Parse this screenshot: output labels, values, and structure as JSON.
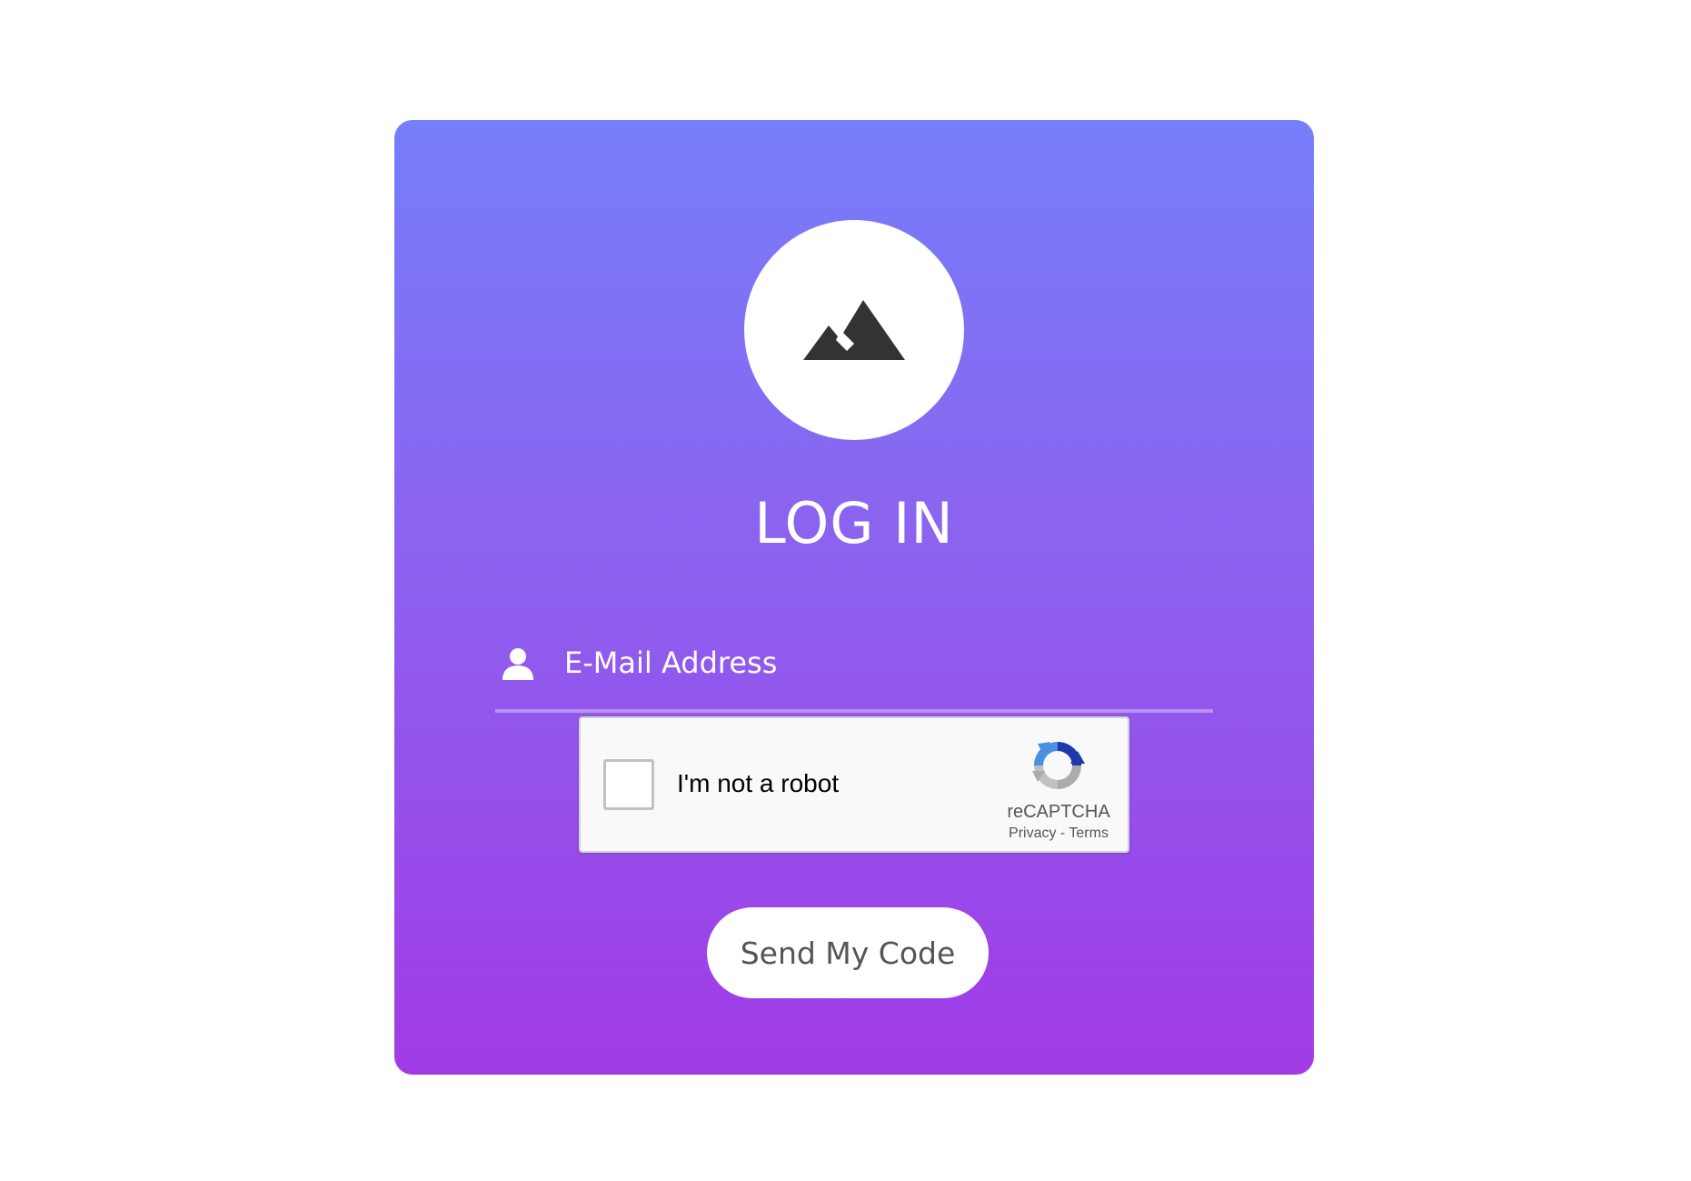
{
  "login": {
    "title": "LOG IN",
    "logo_icon": "mountain-icon",
    "email": {
      "placeholder": "E-Mail Address",
      "value": "",
      "icon": "user-icon"
    },
    "captcha": {
      "label": "I'm not a robot",
      "checked": false,
      "brand": "reCAPTCHA",
      "privacy_label": "Privacy",
      "separator": " - ",
      "terms_label": "Terms",
      "icon": "recaptcha-logo-icon"
    },
    "submit_label": "Send My Code"
  },
  "colors": {
    "gradient_top": "#767ef9",
    "gradient_bottom": "#a13be6",
    "button_text": "#555555"
  }
}
